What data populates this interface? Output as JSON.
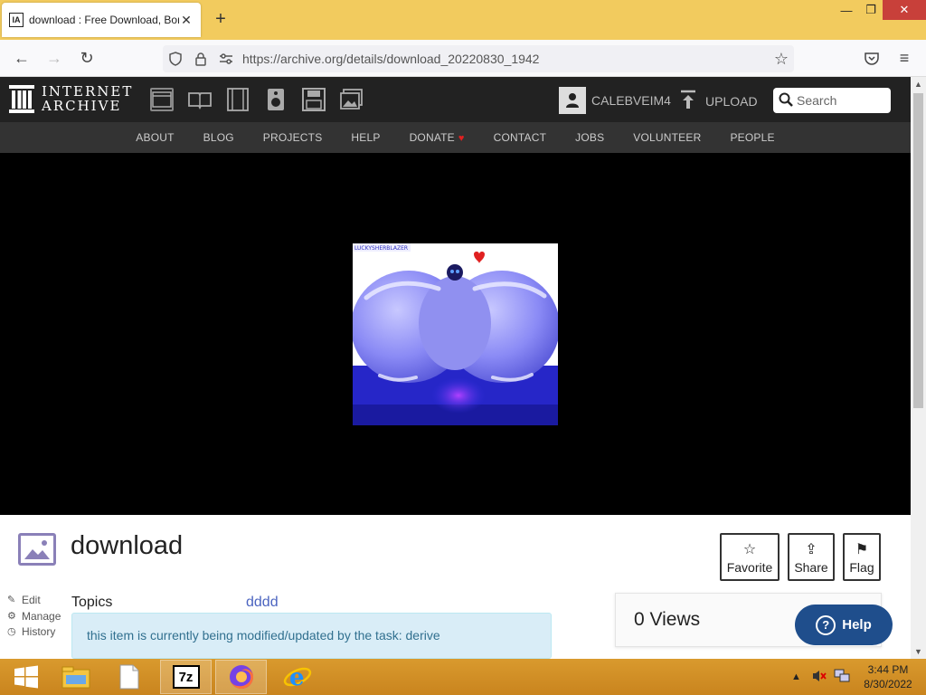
{
  "browser": {
    "tab_title": "download : Free Download, Bor",
    "tab_favicon": "IA",
    "url": "https://archive.org/details/download_20220830_1942",
    "colors": {
      "tabbar": "#f2cb5e",
      "close_button": "#c8403a"
    }
  },
  "ia_header": {
    "logo_line1": "INTERNET",
    "logo_line2": "ARCHIVE",
    "media_icons": [
      "web-icon",
      "texts-icon",
      "video-icon",
      "audio-icon",
      "software-icon",
      "images-icon"
    ],
    "username": "CALEBVEIM4",
    "upload_label": "UPLOAD",
    "search_placeholder": "Search"
  },
  "ia_menu": {
    "items": [
      "ABOUT",
      "BLOG",
      "PROJECTS",
      "HELP",
      "DONATE",
      "CONTACT",
      "JOBS",
      "VOLUNTEER",
      "PEOPLE"
    ],
    "donate_heart": "♥"
  },
  "preview": {
    "watermark": "LUCKYSHERBLAZER"
  },
  "item": {
    "title": "download",
    "actions": [
      {
        "label": "Favorite",
        "glyph": "☆"
      },
      {
        "label": "Share",
        "glyph": "⇪"
      },
      {
        "label": "Flag",
        "glyph": "⚑"
      }
    ],
    "side_links": [
      {
        "label": "Edit",
        "glyph": "✎"
      },
      {
        "label": "Manage",
        "glyph": "⚙"
      },
      {
        "label": "History",
        "glyph": "◷"
      }
    ],
    "topics_label": "Topics",
    "topics_value": "dddd",
    "notice": "this item is currently being modified/updated by the task: derive",
    "views": "0 Views",
    "help_label": "Help",
    "help_glyph": "?"
  },
  "taskbar": {
    "apps": [
      "start-button",
      "file-explorer-icon",
      "notepad-icon",
      "7zip-icon",
      "firefox-icon",
      "internet-explorer-icon"
    ],
    "sevenzip_label": "7z",
    "time": "3:44 PM",
    "date": "8/30/2022"
  }
}
